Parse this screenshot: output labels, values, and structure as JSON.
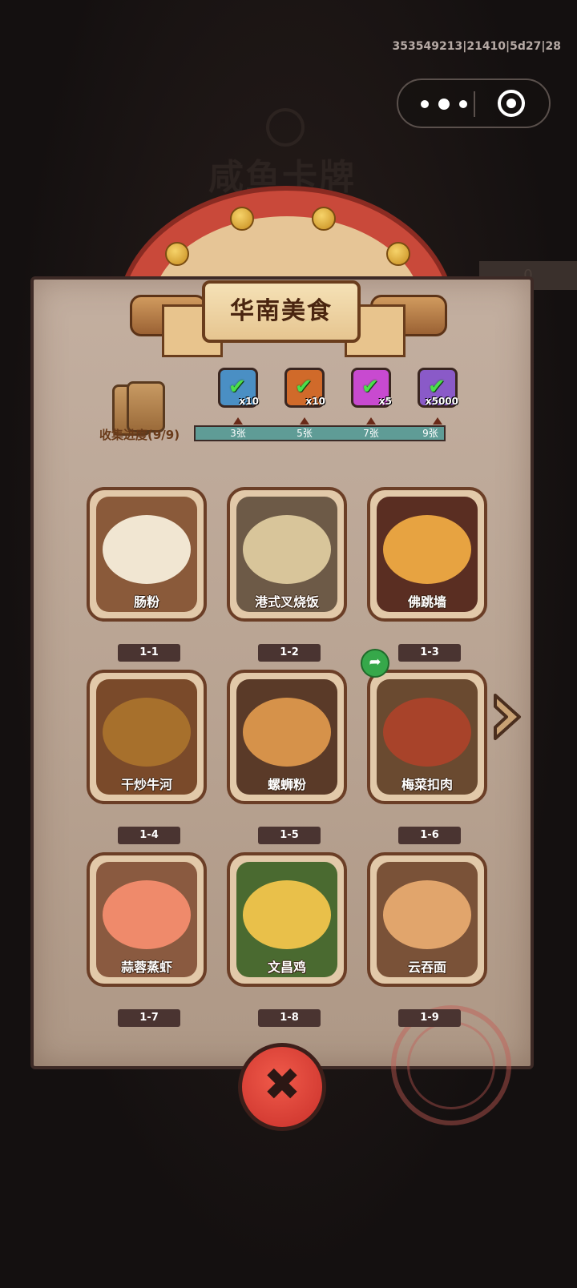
{
  "build_info": "353549213|21410|5d27|28",
  "background_title": "咸鱼卡牌",
  "background_panel_value": "0",
  "banner_title": "华南美食",
  "progress": {
    "label": "收集进度(9/9)",
    "collected": 9,
    "total": 9
  },
  "rewards": [
    {
      "qty": "x10",
      "color": "#4a8fc4",
      "claimed": true
    },
    {
      "qty": "x10",
      "color": "#d06a2a",
      "claimed": true
    },
    {
      "qty": "x5",
      "color": "#c84ad0",
      "claimed": true
    },
    {
      "qty": "x5000",
      "color": "#8a5ac8",
      "claimed": true
    }
  ],
  "milestones": [
    "3张",
    "5张",
    "7张",
    "9张"
  ],
  "cards": [
    {
      "name": "肠粉",
      "code": "1-1",
      "color": "#f1e6d2"
    },
    {
      "name": "港式叉烧饭",
      "code": "1-2",
      "color": "#d8c59a"
    },
    {
      "name": "佛跳墙",
      "code": "1-3",
      "color": "#e7a341"
    },
    {
      "name": "干炒牛河",
      "code": "1-4",
      "color": "#a7702c"
    },
    {
      "name": "螺蛳粉",
      "code": "1-5",
      "color": "#d6924a"
    },
    {
      "name": "梅菜扣肉",
      "code": "1-6",
      "color": "#a8432a"
    },
    {
      "name": "蒜蓉蒸虾",
      "code": "1-7",
      "color": "#ef8a6b"
    },
    {
      "name": "文昌鸡",
      "code": "1-8",
      "color": "#e9c04a"
    },
    {
      "name": "云吞面",
      "code": "1-9",
      "color": "#e1a56c"
    }
  ],
  "close_glyph": "✖",
  "share_glyph": "➦"
}
